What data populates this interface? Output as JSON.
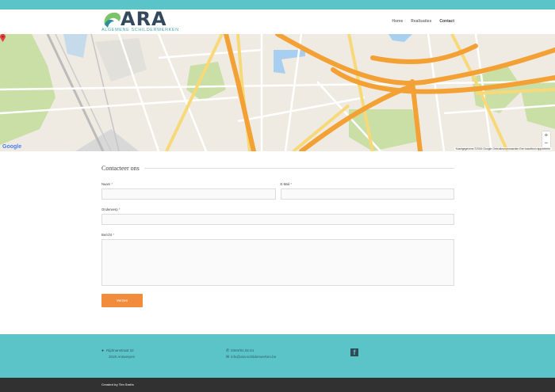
{
  "brand": {
    "name": "ARA",
    "tagline": "ALGEMENE SCHILDERWERKEN",
    "colors": {
      "teal": "#5bc4c9",
      "navy": "#35495e",
      "orange": "#f18c3c"
    }
  },
  "nav": {
    "items": [
      {
        "label": "Home"
      },
      {
        "label": "Realisaties"
      },
      {
        "label": "Contact"
      }
    ]
  },
  "map": {
    "provider_logo": "Google",
    "zoom_in": "+",
    "zoom_out": "−",
    "attribution": "Kaartgegevens ©2016 Google   Gebruiksvoorwaarden   Een kaartfout rapporteren",
    "marker_icon": "map-pin-icon"
  },
  "form": {
    "title": "Contacteer ons",
    "name_label": "Naam",
    "email_label": "E-Mail",
    "subject_label": "Onderwerp",
    "message_label": "Bericht",
    "required_mark": "*",
    "name_value": "",
    "email_value": "",
    "subject_value": "",
    "message_value": "",
    "submit_label": "Verzen"
  },
  "footer": {
    "address_line1": "Rijdmanstraat 32",
    "address_line2": "2020 Antwerpen",
    "phone": "0494/91.02.61",
    "email": "info@ara-schilderwerken.be",
    "credit": "Created by Tim Smits"
  }
}
